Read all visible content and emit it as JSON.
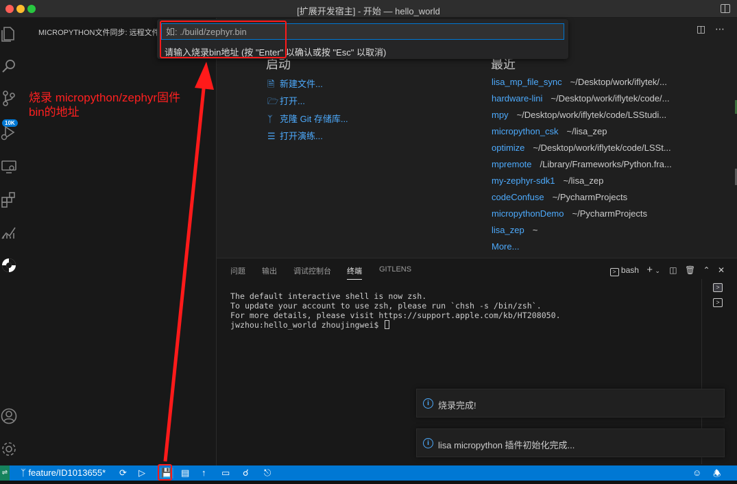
{
  "window": {
    "title": "[扩展开发宿主] - 开始 — hello_world"
  },
  "activity_bar": {
    "badge": "10K",
    "icons": [
      "files-icon",
      "search-icon",
      "source-control-icon",
      "run-debug-icon",
      "remote-explorer-icon",
      "extensions-icon",
      "charts-icon",
      "micropython-icon",
      "account-icon",
      "settings-gear-icon"
    ]
  },
  "sidebar": {
    "title": "MICROPYTHON文件同步: 远程文件"
  },
  "quick_input": {
    "placeholder": "如: ./build/zephyr.bin",
    "message": "请输入烧录bin地址 (按 \"Enter\" 以确认或按 \"Esc\" 以取消)"
  },
  "welcome": {
    "start_heading": "启动",
    "recent_heading": "最近",
    "start_items": [
      {
        "icon": "new-file-icon",
        "label": "新建文件..."
      },
      {
        "icon": "folder-open-icon",
        "label": "打开..."
      },
      {
        "icon": "git-clone-icon",
        "label": "克隆 Git 存储库..."
      },
      {
        "icon": "walkthrough-icon",
        "label": "打开演练..."
      }
    ],
    "recent": [
      {
        "name": "lisa_mp_file_sync",
        "path": "~/Desktop/work/iflytek/..."
      },
      {
        "name": "hardware-lini",
        "path": "~/Desktop/work/iflytek/code/..."
      },
      {
        "name": "mpy",
        "path": "~/Desktop/work/iflytek/code/LSStudi..."
      },
      {
        "name": "micropython_csk",
        "path": "~/lisa_zep"
      },
      {
        "name": "optimize",
        "path": "~/Desktop/work/iflytek/code/LSSt..."
      },
      {
        "name": "mpremote",
        "path": "/Library/Frameworks/Python.fra..."
      },
      {
        "name": "my-zephyr-sdk1",
        "path": "~/lisa_zep"
      },
      {
        "name": "codeConfuse",
        "path": "~/PycharmProjects"
      },
      {
        "name": "micropythonDemo",
        "path": "~/PycharmProjects"
      },
      {
        "name": "lisa_zep",
        "path": "~"
      }
    ],
    "more": "More..."
  },
  "panel": {
    "tabs": [
      "问题",
      "输出",
      "调试控制台",
      "终端",
      "GITLENS"
    ],
    "active_tab": "终端",
    "shell": "bash",
    "terminal_lines": [
      "The default interactive shell is now zsh.",
      "To update your account to use zsh, please run `chsh -s /bin/zsh`.",
      "For more details, please visit https://support.apple.com/kb/HT208050.",
      "jwzhou:hello_world zhoujingwei$ "
    ]
  },
  "notifications": [
    {
      "text": "烧录完成!"
    },
    {
      "text": "lisa micropython 插件初始化完成..."
    }
  ],
  "statusbar": {
    "branch": "feature/ID1013655*"
  },
  "annotation": {
    "line1": "烧录 micropython/zephyr固件",
    "line2": "bin的地址",
    "color": "#ff1a1a"
  }
}
